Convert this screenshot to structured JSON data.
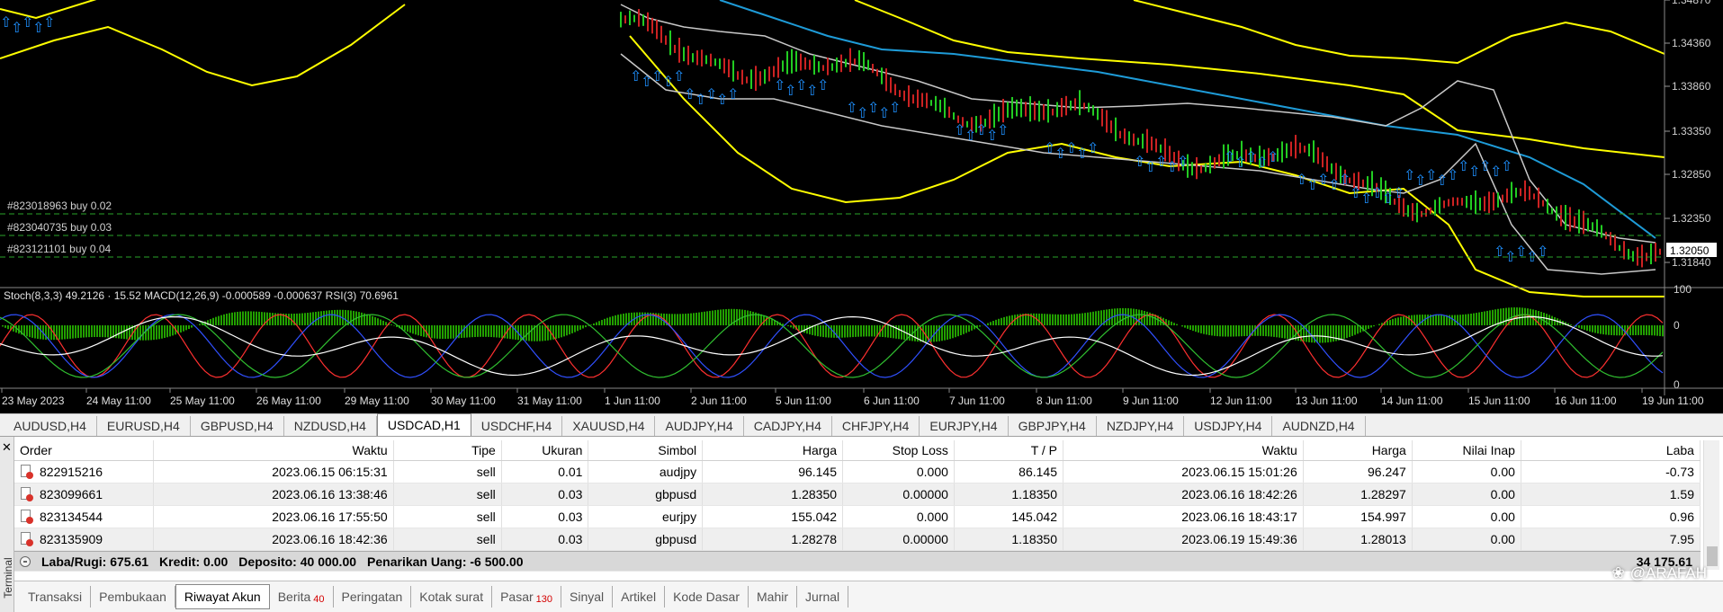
{
  "chart": {
    "price_labels": [
      "1.34870",
      "1.34360",
      "1.33860",
      "1.33350",
      "1.32850",
      "1.32350",
      "1.31840"
    ],
    "current_price": "1.32050",
    "order_lines": [
      "#823018963 buy 0.02",
      "#823040735 buy 0.03",
      "#823121101 buy 0.04"
    ],
    "indicator_label": "Stoch(8,3,3) 49.2126 · 15.52 MACD(12,26,9) -0.000589 -0.000637  RSI(3) 70.6961",
    "indicator_scale": [
      "100",
      "0",
      "0"
    ],
    "time_labels": [
      "23 May 2023",
      "24 May 11:00",
      "25 May 11:00",
      "26 May 11:00",
      "29 May 11:00",
      "30 May 11:00",
      "31 May 11:00",
      "1 Jun 11:00",
      "2 Jun 11:00",
      "5 Jun 11:00",
      "6 Jun 11:00",
      "7 Jun 11:00",
      "8 Jun 11:00",
      "9 Jun 11:00",
      "12 Jun 11:00",
      "13 Jun 11:00",
      "14 Jun 11:00",
      "15 Jun 11:00",
      "16 Jun 11:00",
      "19 Jun 11:00"
    ],
    "colors": {
      "background": "#000000",
      "bands": "#ffff00",
      "ma": "#1e9bd7",
      "envelope": "#c8c8c8",
      "macd": "#22a000",
      "arrows": "#1e90ff",
      "order_line": "#2aa52a"
    }
  },
  "symbol_tabs": [
    "AUDUSD,H4",
    "EURUSD,H4",
    "GBPUSD,H4",
    "NZDUSD,H4",
    "USDCAD,H1",
    "USDCHF,H4",
    "XAUUSD,H4",
    "AUDJPY,H4",
    "CADJPY,H4",
    "CHFJPY,H4",
    "EURJPY,H4",
    "GBPJPY,H4",
    "NZDJPY,H4",
    "USDJPY,H4",
    "AUDNZD,H4"
  ],
  "active_symbol_tab": "USDCAD,H1",
  "terminal": {
    "side_label": "Terminal",
    "columns": [
      "Order",
      "Waktu",
      "Tipe",
      "Ukuran",
      "Simbol",
      "Harga",
      "Stop Loss",
      "T / P",
      "Waktu",
      "Harga",
      "Nilai Inap",
      "Laba"
    ],
    "rows": [
      [
        "822915216",
        "2023.06.15 06:15:31",
        "sell",
        "0.01",
        "audjpy",
        "96.145",
        "0.000",
        "86.145",
        "2023.06.15 15:01:26",
        "96.247",
        "0.00",
        "-0.73"
      ],
      [
        "823099661",
        "2023.06.16 13:38:46",
        "sell",
        "0.03",
        "gbpusd",
        "1.28350",
        "0.00000",
        "1.18350",
        "2023.06.16 18:42:26",
        "1.28297",
        "0.00",
        "1.59"
      ],
      [
        "823134544",
        "2023.06.16 17:55:50",
        "sell",
        "0.03",
        "eurjpy",
        "155.042",
        "0.000",
        "145.042",
        "2023.06.16 18:43:17",
        "154.997",
        "0.00",
        "0.96"
      ],
      [
        "823135909",
        "2023.06.16 18:42:36",
        "sell",
        "0.03",
        "gbpusd",
        "1.28278",
        "0.00000",
        "1.18350",
        "2023.06.19 15:49:36",
        "1.28013",
        "0.00",
        "7.95"
      ]
    ],
    "summary": {
      "laba_rugi": "Laba/Rugi: 675.61",
      "kredit": "Kredit: 0.00",
      "deposito": "Deposito: 40 000.00",
      "penarikan": "Penarikan Uang: -6 500.00",
      "total": "34 175.61"
    }
  },
  "bottom_tabs": [
    {
      "label": "Transaksi",
      "badge": ""
    },
    {
      "label": "Pembukaan",
      "badge": ""
    },
    {
      "label": "Riwayat Akun",
      "badge": ""
    },
    {
      "label": "Berita",
      "badge": "40"
    },
    {
      "label": "Peringatan",
      "badge": ""
    },
    {
      "label": "Kotak surat",
      "badge": ""
    },
    {
      "label": "Pasar",
      "badge": "130"
    },
    {
      "label": "Sinyal",
      "badge": ""
    },
    {
      "label": "Artikel",
      "badge": ""
    },
    {
      "label": "Kode Dasar",
      "badge": ""
    },
    {
      "label": "Mahir",
      "badge": ""
    },
    {
      "label": "Jurnal",
      "badge": ""
    }
  ],
  "active_bottom_tab": "Riwayat Akun",
  "watermark": "@ARAFAH"
}
